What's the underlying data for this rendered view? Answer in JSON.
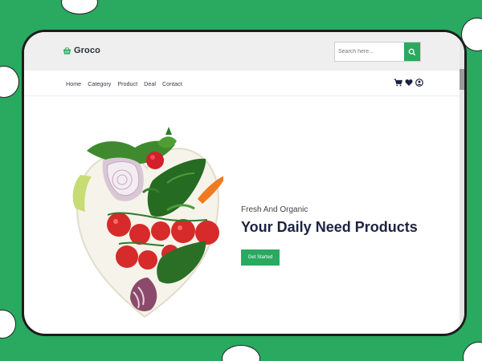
{
  "brand": {
    "name": "Groco",
    "accent": "#2aa960"
  },
  "search": {
    "placeholder": "Search here...",
    "icon": "search-icon"
  },
  "nav": {
    "links": [
      {
        "label": "Home"
      },
      {
        "label": "Category"
      },
      {
        "label": "Product"
      },
      {
        "label": "Deal"
      },
      {
        "label": "Contact"
      }
    ],
    "icons": [
      "cart-icon",
      "heart-icon",
      "user-icon"
    ]
  },
  "hero": {
    "subtitle": "Fresh And Organic",
    "title": "Your Daily Need Products",
    "cta_label": "Get Started"
  }
}
